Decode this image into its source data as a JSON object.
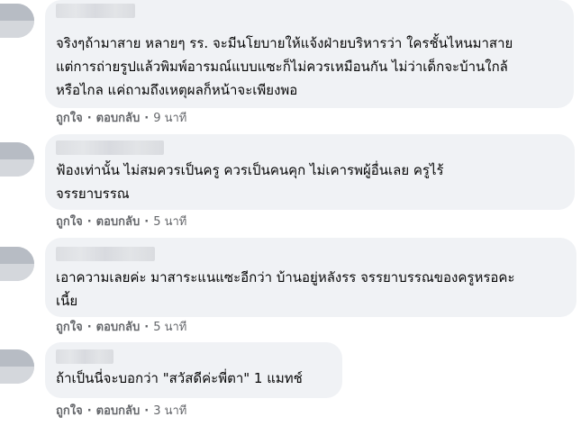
{
  "comments": [
    {
      "lines": [
        "จริงๆถ้ามาสาย หลายๆ รร. จะมีนโยบายให้แจ้งฝ่ายบริหารว่า ใครชั้นไหนมาสาย",
        "แต่การถ่ายรูปแล้วพิมพ์อารมณ์แบบแซะก็ไม่ควรเหมือนกัน ไม่ว่าเด็กจะบ้านใกล้",
        "หรือไกล แค่ถามถึงเหตุผลก็หน้าจะเพียงพอ"
      ],
      "like_label": "ถูกใจ",
      "reply_label": "ตอบกลับ",
      "separator": "·",
      "time": "9 นาที"
    },
    {
      "lines": [
        "ฟ้องเท่านั้น ไม่สมควรเป็นครู ควรเป็นคนคุก ไม่เคารพผู้อื่นเลย ครูไร้",
        "จรรยาบรรณ"
      ],
      "like_label": "ถูกใจ",
      "reply_label": "ตอบกลับ",
      "separator": "·",
      "time": "5 นาที"
    },
    {
      "lines": [
        "เอาความเลยค่ะ มาสาระแนแซะอีกว่า บ้านอยู่หลังรร จรรยาบรรณของครูหรอคะ",
        "เนี้ย"
      ],
      "like_label": "ถูกใจ",
      "reply_label": "ตอบกลับ",
      "separator": "·",
      "time": "5 นาที"
    },
    {
      "lines": [
        "ถ้าเป็นนี่จะบอกว่า \"สวัสดีค่ะพี่ตา\" 1 แมทช์"
      ],
      "like_label": "ถูกใจ",
      "reply_label": "ตอบกลับ",
      "separator": "·",
      "time": "3 นาที"
    }
  ],
  "colors": {
    "bubble": "#f0f2f5",
    "text": "#050505",
    "meta": "#65676b"
  }
}
